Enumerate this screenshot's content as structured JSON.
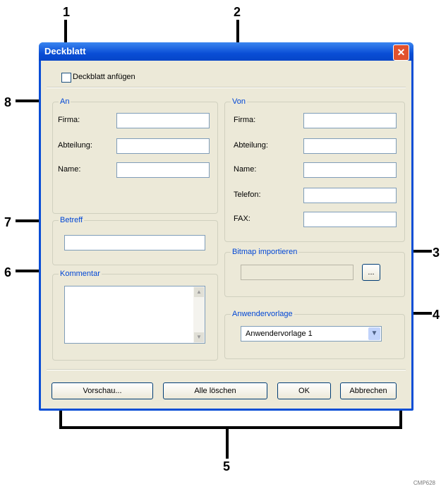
{
  "callouts": [
    "1",
    "2",
    "3",
    "4",
    "5",
    "6",
    "7",
    "8"
  ],
  "window": {
    "title": "Deckblatt",
    "close_glyph": "✕",
    "checkbox_label": "Deckblatt anfügen",
    "to_group": {
      "label": "An",
      "fields": [
        "Firma:",
        "Abteilung:",
        "Name:"
      ]
    },
    "from_group": {
      "label": "Von",
      "fields": [
        "Firma:",
        "Abteilung:",
        "Name:",
        "Telefon:",
        "FAX:"
      ]
    },
    "subject_label": "Betreff",
    "comment_label": "Kommentar",
    "bitmap_label": "Bitmap importieren",
    "browse_label": "...",
    "template_label": "Anwendervorlage",
    "template_value": "Anwendervorlage 1",
    "buttons": {
      "preview": "Vorschau...",
      "clear_all": "Alle löschen",
      "ok": "OK",
      "cancel": "Abbrechen"
    }
  },
  "image_code": "CMP628"
}
